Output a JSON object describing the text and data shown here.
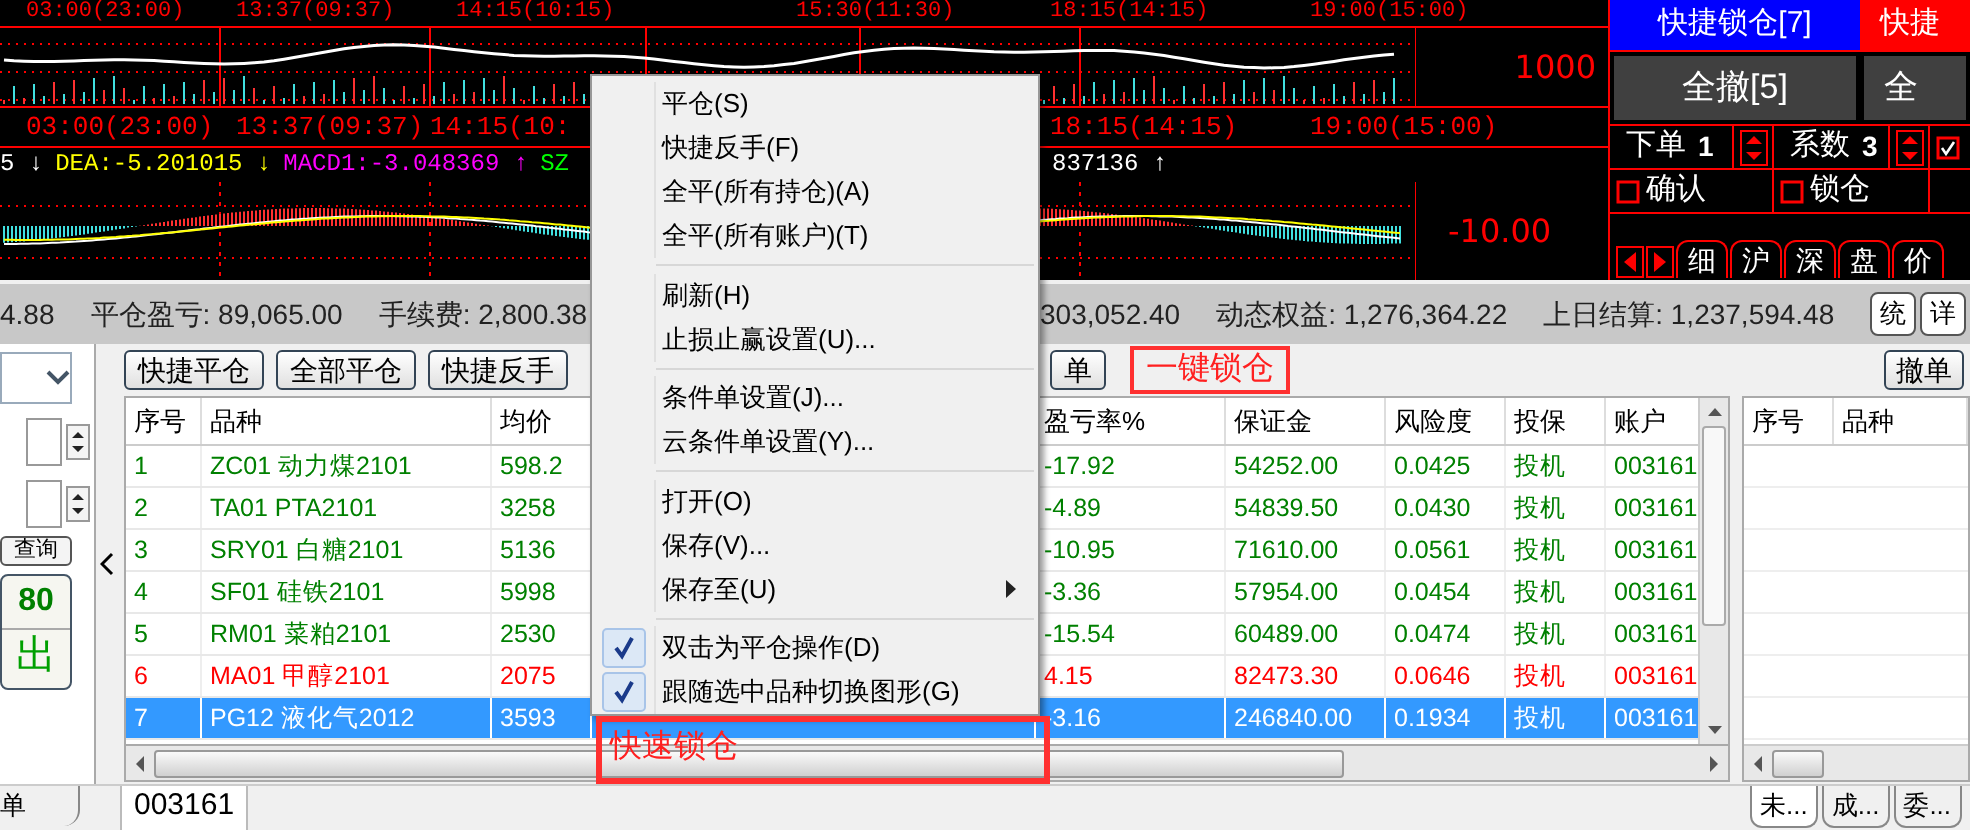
{
  "chart": {
    "top_time_labels": [
      "03:00(23:00)",
      "13:37(09:37)",
      "14:15(10:15)",
      "15:30(11:30)",
      "18:15(14:15)",
      "19:00(15:00)"
    ],
    "price_label": "1000",
    "time_labels": [
      "03:00(23:00)",
      "13:37(09:37)",
      "14:15(10:",
      "18:15(14:15)",
      "19:00(15:00)"
    ],
    "indicators": [
      {
        "text": "5 ↓",
        "color": "#ffffff"
      },
      {
        "text": "DEA:-5.201015 ↓",
        "color": "#ffff00"
      },
      {
        "text": "MACD1:-3.048369 ↑",
        "color": "#ff00ff"
      },
      {
        "text": "SZ",
        "color": "#00ff00"
      },
      {
        "text": "837136 ↑",
        "color": "#ffffff"
      }
    ],
    "macd_label": "-10.00"
  },
  "quick_panel": {
    "buttons": [
      {
        "label": "快捷锁仓[7]",
        "color": "#0000ff"
      },
      {
        "label": "快捷",
        "color": "#ff0000"
      },
      {
        "label": "全撤[5]",
        "color": "#404040"
      },
      {
        "label": "全",
        "color": "#404040"
      }
    ],
    "spinners": [
      {
        "label": "下单",
        "value": "1"
      },
      {
        "label": "系数",
        "value": "3"
      }
    ],
    "checkboxes": [
      {
        "checked": true
      },
      {
        "label": "确认",
        "checked": false
      },
      {
        "label": "锁仓",
        "checked": false
      }
    ],
    "tabs": [
      "细",
      "沪",
      "深",
      "盘",
      "价"
    ]
  },
  "status_bar": {
    "items": [
      "4.88",
      "平仓盈亏: 89,065.00",
      "手续费: 2,800.38",
      "303,052.40",
      "动态权益: 1,276,364.22",
      "上日结算: 1,237,594.48"
    ],
    "buttons": [
      "统",
      "详"
    ]
  },
  "order_panel": {
    "query_button": "查询",
    "price": "80",
    "action": "出"
  },
  "positions": {
    "toolbar": [
      "快捷平仓",
      "全部平仓",
      "快捷反手",
      "单"
    ],
    "toolbar_annotation": "一键锁仓",
    "columns": [
      "序号",
      "品种",
      "均价",
      "盈亏率%",
      "保证金",
      "风险度",
      "投保",
      "账户"
    ],
    "rows": [
      {
        "cells": [
          "1",
          "ZC01 动力煤2101",
          "598.2",
          "-17.92",
          "54252.00",
          "0.0425",
          "投机",
          "003161"
        ],
        "color": "#008000",
        "selected": false
      },
      {
        "cells": [
          "2",
          "TA01 PTA2101",
          "3258",
          "-4.89",
          "54839.50",
          "0.0430",
          "投机",
          "003161"
        ],
        "color": "#008000",
        "selected": false
      },
      {
        "cells": [
          "3",
          "SRY01 白糖2101",
          "5136",
          "-10.95",
          "71610.00",
          "0.0561",
          "投机",
          "003161"
        ],
        "color": "#008000",
        "selected": false
      },
      {
        "cells": [
          "4",
          "SF01 硅铁2101",
          "5998",
          "-3.36",
          "57954.00",
          "0.0454",
          "投机",
          "003161"
        ],
        "color": "#008000",
        "selected": false
      },
      {
        "cells": [
          "5",
          "RM01 菜粕2101",
          "2530",
          "-15.54",
          "60489.00",
          "0.0474",
          "投机",
          "003161"
        ],
        "color": "#008000",
        "selected": false
      },
      {
        "cells": [
          "6",
          "MA01 甲醇2101",
          "2075",
          "4.15",
          "82473.30",
          "0.0646",
          "投机",
          "003161"
        ],
        "color": "#ff0000",
        "selected": false
      },
      {
        "cells": [
          "7",
          "PG12 液化气2012",
          "3593",
          "-3.16",
          "246840.00",
          "0.1934",
          "投机",
          "003161"
        ],
        "selected": true
      }
    ]
  },
  "orders": {
    "button": "撤单",
    "columns": [
      "序号",
      "品种"
    ],
    "tabs": [
      "未...",
      "成...",
      "委..."
    ]
  },
  "bottom_tabs": [
    "单",
    "003161"
  ],
  "context_menu": [
    {
      "kind": "item",
      "label": "平仓(S)",
      "checked": false,
      "submenu": false
    },
    {
      "kind": "item",
      "label": "快捷反手(F)",
      "checked": false,
      "submenu": false
    },
    {
      "kind": "item",
      "label": "全平(所有持仓)(A)",
      "checked": false,
      "submenu": false
    },
    {
      "kind": "item",
      "label": "全平(所有账户)(T)",
      "checked": false,
      "submenu": false
    },
    {
      "kind": "separator"
    },
    {
      "kind": "item",
      "label": "刷新(H)",
      "checked": false,
      "submenu": false
    },
    {
      "kind": "item",
      "label": "止损止赢设置(U)...",
      "checked": false,
      "submenu": false
    },
    {
      "kind": "separator"
    },
    {
      "kind": "item",
      "label": "条件单设置(J)...",
      "checked": false,
      "submenu": false
    },
    {
      "kind": "item",
      "label": "云条件单设置(Y)...",
      "checked": false,
      "submenu": false
    },
    {
      "kind": "separator"
    },
    {
      "kind": "item",
      "label": "打开(O)",
      "checked": false,
      "submenu": false
    },
    {
      "kind": "item",
      "label": "保存(V)...",
      "checked": false,
      "submenu": false
    },
    {
      "kind": "item",
      "label": "保存至(U)",
      "checked": false,
      "submenu": true
    },
    {
      "kind": "separator"
    },
    {
      "kind": "item",
      "label": "双击为平仓操作(D)",
      "checked": true,
      "submenu": false
    },
    {
      "kind": "item",
      "label": "跟随选中品种切换图形(G)",
      "checked": true,
      "submenu": false
    }
  ],
  "overlay_annotation": "快速锁仓"
}
